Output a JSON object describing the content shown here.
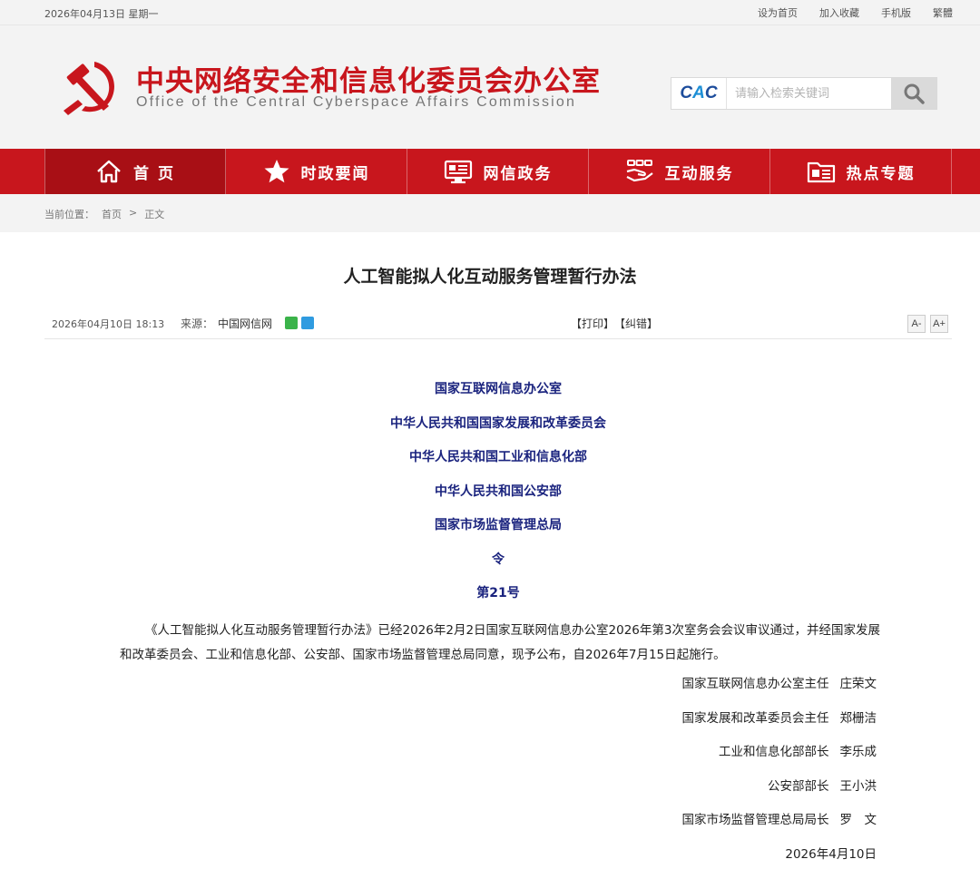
{
  "topbar": {
    "date": "2026年04月13日 星期一",
    "links": [
      "设为首页",
      "加入收藏",
      "手机版",
      "繁體"
    ]
  },
  "header": {
    "title_cn": "中央网络安全和信息化委员会办公室",
    "title_en": "Office of the Central Cyberspace Affairs Commission",
    "search_logo_a": "C",
    "search_logo_b": "A",
    "search_logo_c": "C",
    "search_placeholder": "请输入检索关键词"
  },
  "nav": {
    "items": [
      {
        "label": "首 页",
        "icon": "home-icon"
      },
      {
        "label": "时政要闻",
        "icon": "star-icon"
      },
      {
        "label": "网信政务",
        "icon": "monitor-icon"
      },
      {
        "label": "互动服务",
        "icon": "handshake-icon"
      },
      {
        "label": "热点专题",
        "icon": "folder-icon"
      }
    ]
  },
  "breadcrumb": {
    "prefix": "当前位置：",
    "home": "首页",
    "sep": ">",
    "current": "正文"
  },
  "article": {
    "title": "人工智能拟人化互动服务管理暂行办法",
    "time": "2026年04月10日  18:13",
    "source_label": "来源：",
    "source": "中国网信网",
    "print": "【打印】",
    "correct": "【纠错】",
    "font_small": "A-",
    "font_large": "A+",
    "issuers": [
      "国家互联网信息办公室",
      "中华人民共和国国家发展和改革委员会",
      "中华人民共和国工业和信息化部",
      "中华人民共和国公安部",
      "国家市场监督管理总局",
      "令",
      "第21号"
    ],
    "body": "《人工智能拟人化互动服务管理暂行办法》已经2026年2月2日国家互联网信息办公室2026年第3次室务会会议审议通过，并经国家发展和改革委员会、工业和信息化部、公安部、国家市场监督管理总局同意，现予公布，自2026年7月15日起施行。",
    "signatories": [
      {
        "role": "国家互联网信息办公室主任",
        "name": "庄荣文"
      },
      {
        "role": "国家发展和改革委员会主任",
        "name": "郑栅洁"
      },
      {
        "role": "工业和信息化部部长",
        "name": "李乐成"
      },
      {
        "role": "公安部部长",
        "name": "王小洪"
      },
      {
        "role": "国家市场监督管理总局局长",
        "name": "罗　文"
      }
    ],
    "date_signed": "2026年4月10日"
  },
  "colors": {
    "brand_red": "#c8161d",
    "issuer_blue": "#1a237e",
    "wechat_green": "#3bb34a",
    "qzone_blue": "#2f9be0"
  }
}
